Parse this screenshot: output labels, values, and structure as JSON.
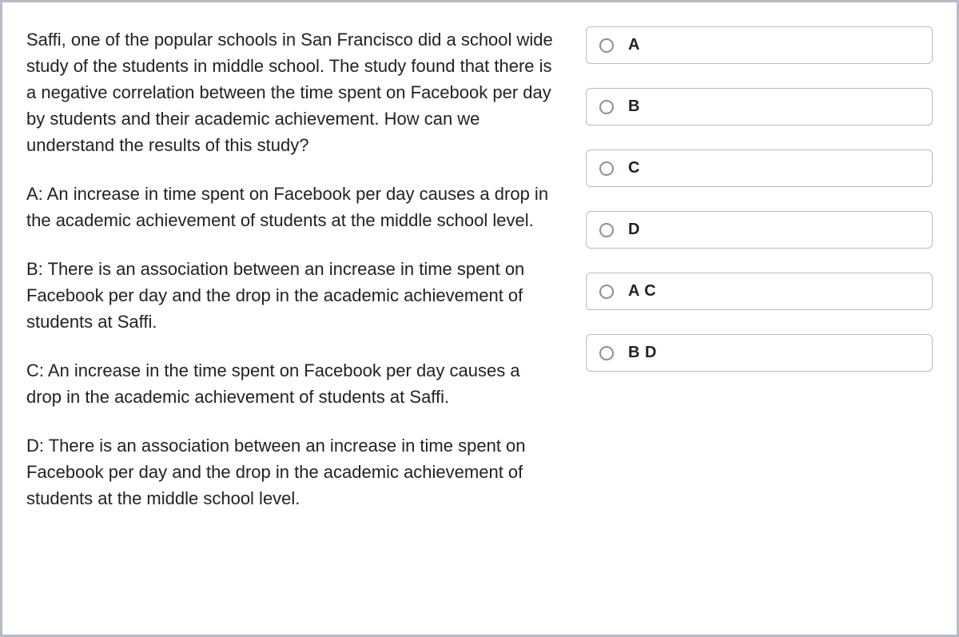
{
  "question": {
    "prompt": "Saffi, one of the popular schools in San Francisco did a school wide study of the students in middle school. The study found that there is a negative correlation between the time spent on Facebook per day by students and their academic achievement. How can we understand the results of this study?",
    "statements": [
      "A: An increase in time spent on Facebook per day causes a drop in the academic achievement of students at the middle school level.",
      "B: There is an association between an increase in time spent on Facebook per day and the drop in the academic achievement of students at Saffi.",
      "C: An increase in the time spent on Facebook per day causes a drop in the academic achievement of students at Saffi.",
      "D: There is an association between an increase in time spent on Facebook per day and the drop in the academic achievement of students at the middle school level."
    ]
  },
  "options": [
    {
      "label": "A"
    },
    {
      "label": "B"
    },
    {
      "label": "C"
    },
    {
      "label": "D"
    },
    {
      "label": "A C"
    },
    {
      "label": "B D"
    }
  ]
}
